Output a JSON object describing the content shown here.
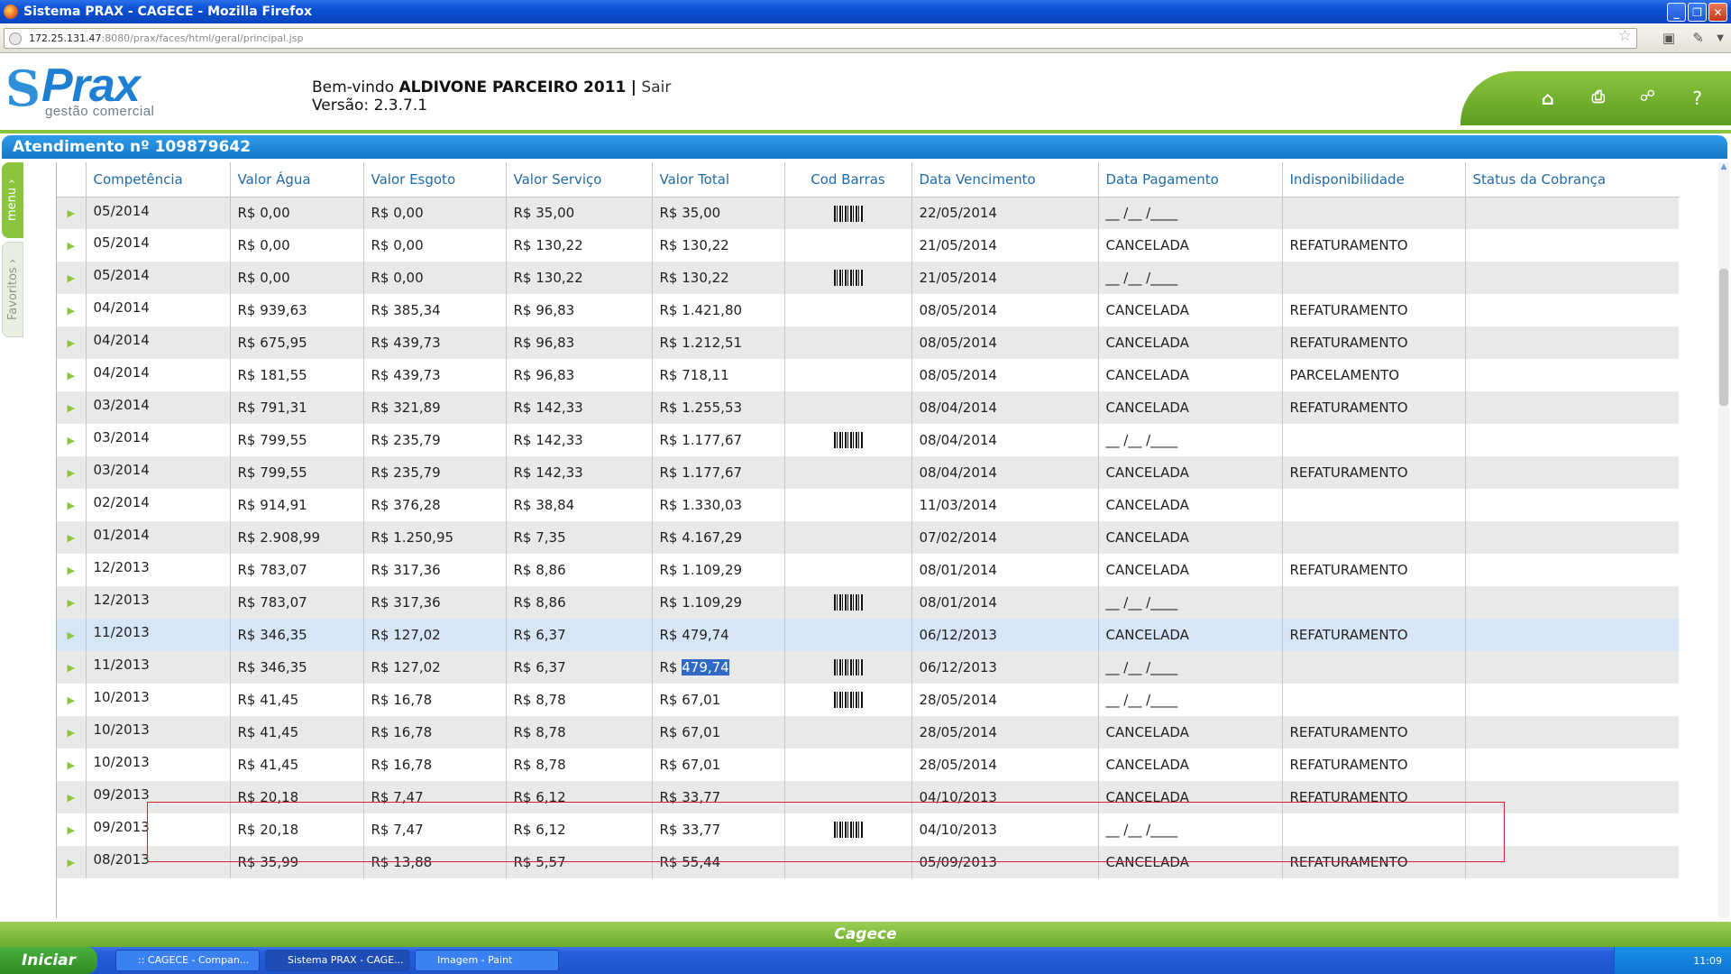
{
  "window": {
    "title": "Sistema PRAX - CAGECE - Mozilla Firefox",
    "minimize_glyph": "_",
    "maximize_glyph": "❐",
    "close_glyph": "✕"
  },
  "browser": {
    "url_host": "172.25.131.47",
    "url_rest": ":8080/prax/faces/html/geral/principal.jsp"
  },
  "app": {
    "logo_mark": "S",
    "logo_text": "Prax",
    "logo_subtitle": "gestão comercial",
    "welcome_prefix": "Bem-vindo",
    "user_name": "ALDIVONE PARCEIRO 2011",
    "separator": "|",
    "logout_label": "Sair",
    "version_label": "Versão: 2.3.7.1",
    "header_icons": [
      "home-icon",
      "print-icon",
      "sitemap-icon",
      "help-icon"
    ],
    "help_glyph": "?",
    "atendimento_title": "Atendimento nº 109879642",
    "side_tab_menu": "menu",
    "side_tab_favoritos": "Favoritos",
    "footer_brand": "Cagece"
  },
  "table": {
    "columns": [
      "Competência",
      "Valor Água",
      "Valor Esgoto",
      "Valor Serviço",
      "Valor Total",
      "Cod Barras",
      "Data Vencimento",
      "Data Pagamento",
      "Indisponibilidade",
      "Status da Cobrança"
    ],
    "rows": [
      {
        "competencia": "05/2014",
        "agua": "R$ 0,00",
        "esgoto": "R$ 0,00",
        "servico": "R$ 35,00",
        "total": "R$ 35,00",
        "barcode": true,
        "vencimento": "22/05/2014",
        "pagamento": "__ /__ /____",
        "indisp": "",
        "status": ""
      },
      {
        "competencia": "05/2014",
        "agua": "R$ 0,00",
        "esgoto": "R$ 0,00",
        "servico": "R$ 130,22",
        "total": "R$ 130,22",
        "barcode": false,
        "vencimento": "21/05/2014",
        "pagamento": "CANCELADA",
        "indisp": "REFATURAMENTO",
        "status": ""
      },
      {
        "competencia": "05/2014",
        "agua": "R$ 0,00",
        "esgoto": "R$ 0,00",
        "servico": "R$ 130,22",
        "total": "R$ 130,22",
        "barcode": true,
        "vencimento": "21/05/2014",
        "pagamento": "__ /__ /____",
        "indisp": "",
        "status": ""
      },
      {
        "competencia": "04/2014",
        "agua": "R$ 939,63",
        "esgoto": "R$ 385,34",
        "servico": "R$ 96,83",
        "total": "R$ 1.421,80",
        "barcode": false,
        "vencimento": "08/05/2014",
        "pagamento": "CANCELADA",
        "indisp": "REFATURAMENTO",
        "status": ""
      },
      {
        "competencia": "04/2014",
        "agua": "R$ 675,95",
        "esgoto": "R$ 439,73",
        "servico": "R$ 96,83",
        "total": "R$ 1.212,51",
        "barcode": false,
        "vencimento": "08/05/2014",
        "pagamento": "CANCELADA",
        "indisp": "REFATURAMENTO",
        "status": ""
      },
      {
        "competencia": "04/2014",
        "agua": "R$ 181,55",
        "esgoto": "R$ 439,73",
        "servico": "R$ 96,83",
        "total": "R$ 718,11",
        "barcode": false,
        "vencimento": "08/05/2014",
        "pagamento": "CANCELADA",
        "indisp": "PARCELAMENTO",
        "status": ""
      },
      {
        "competencia": "03/2014",
        "agua": "R$ 791,31",
        "esgoto": "R$ 321,89",
        "servico": "R$ 142,33",
        "total": "R$ 1.255,53",
        "barcode": false,
        "vencimento": "08/04/2014",
        "pagamento": "CANCELADA",
        "indisp": "REFATURAMENTO",
        "status": ""
      },
      {
        "competencia": "03/2014",
        "agua": "R$ 799,55",
        "esgoto": "R$ 235,79",
        "servico": "R$ 142,33",
        "total": "R$ 1.177,67",
        "barcode": true,
        "vencimento": "08/04/2014",
        "pagamento": "__ /__ /____",
        "indisp": "",
        "status": ""
      },
      {
        "competencia": "03/2014",
        "agua": "R$ 799,55",
        "esgoto": "R$ 235,79",
        "servico": "R$ 142,33",
        "total": "R$ 1.177,67",
        "barcode": false,
        "vencimento": "08/04/2014",
        "pagamento": "CANCELADA",
        "indisp": "REFATURAMENTO",
        "status": ""
      },
      {
        "competencia": "02/2014",
        "agua": "R$ 914,91",
        "esgoto": "R$ 376,28",
        "servico": "R$ 38,84",
        "total": "R$ 1.330,03",
        "barcode": false,
        "vencimento": "11/03/2014",
        "pagamento": "CANCELADA",
        "indisp": "",
        "status": ""
      },
      {
        "competencia": "01/2014",
        "agua": "R$ 2.908,99",
        "esgoto": "R$ 1.250,95",
        "servico": "R$ 7,35",
        "total": "R$ 4.167,29",
        "barcode": false,
        "vencimento": "07/02/2014",
        "pagamento": "CANCELADA",
        "indisp": "",
        "status": ""
      },
      {
        "competencia": "12/2013",
        "agua": "R$ 783,07",
        "esgoto": "R$ 317,36",
        "servico": "R$ 8,86",
        "total": "R$ 1.109,29",
        "barcode": false,
        "vencimento": "08/01/2014",
        "pagamento": "CANCELADA",
        "indisp": "REFATURAMENTO",
        "status": ""
      },
      {
        "competencia": "12/2013",
        "agua": "R$ 783,07",
        "esgoto": "R$ 317,36",
        "servico": "R$ 8,86",
        "total": "R$ 1.109,29",
        "barcode": true,
        "vencimento": "08/01/2014",
        "pagamento": "__ /__ /____",
        "indisp": "",
        "status": ""
      },
      {
        "competencia": "11/2013",
        "agua": "R$ 346,35",
        "esgoto": "R$ 127,02",
        "servico": "R$ 6,37",
        "total": "R$ 479,74",
        "barcode": false,
        "vencimento": "06/12/2013",
        "pagamento": "CANCELADA",
        "indisp": "REFATURAMENTO",
        "status": ""
      },
      {
        "competencia": "11/2013",
        "agua": "R$ 346,35",
        "esgoto": "R$ 127,02",
        "servico": "R$ 6,37",
        "total": "R$ 479,74",
        "barcode": true,
        "vencimento": "06/12/2013",
        "pagamento": "__ /__ /____",
        "indisp": "",
        "status": ""
      },
      {
        "competencia": "10/2013",
        "agua": "R$ 41,45",
        "esgoto": "R$ 16,78",
        "servico": "R$ 8,78",
        "total": "R$ 67,01",
        "barcode": true,
        "vencimento": "28/05/2014",
        "pagamento": "__ /__ /____",
        "indisp": "",
        "status": ""
      },
      {
        "competencia": "10/2013",
        "agua": "R$ 41,45",
        "esgoto": "R$ 16,78",
        "servico": "R$ 8,78",
        "total": "R$ 67,01",
        "barcode": false,
        "vencimento": "28/05/2014",
        "pagamento": "CANCELADA",
        "indisp": "REFATURAMENTO",
        "status": ""
      },
      {
        "competencia": "10/2013",
        "agua": "R$ 41,45",
        "esgoto": "R$ 16,78",
        "servico": "R$ 8,78",
        "total": "R$ 67,01",
        "barcode": false,
        "vencimento": "28/05/2014",
        "pagamento": "CANCELADA",
        "indisp": "REFATURAMENTO",
        "status": ""
      },
      {
        "competencia": "09/2013",
        "agua": "R$ 20,18",
        "esgoto": "R$ 7,47",
        "servico": "R$ 6,12",
        "total": "R$ 33,77",
        "barcode": false,
        "vencimento": "04/10/2013",
        "pagamento": "CANCELADA",
        "indisp": "REFATURAMENTO",
        "status": ""
      },
      {
        "competencia": "09/2013",
        "agua": "R$ 20,18",
        "esgoto": "R$ 7,47",
        "servico": "R$ 6,12",
        "total": "R$ 33,77",
        "barcode": true,
        "vencimento": "04/10/2013",
        "pagamento": "__ /__ /____",
        "indisp": "",
        "status": ""
      },
      {
        "competencia": "08/2013",
        "agua": "R$ 35,99",
        "esgoto": "R$ 13,88",
        "servico": "R$ 5,57",
        "total": "R$ 55,44",
        "barcode": false,
        "vencimento": "05/09/2013",
        "pagamento": "CANCELADA",
        "indisp": "REFATURAMENTO",
        "status": ""
      }
    ],
    "selected_row_index": 13,
    "highlighted_text": {
      "row_index": 14,
      "prefix": "R$ ",
      "selected": "479,74"
    }
  },
  "taskbar": {
    "start_label": "Iniciar",
    "tasks": [
      ":: CAGECE - Compan...",
      "Sistema PRAX - CAGE...",
      "Imagem - Paint"
    ],
    "clock": "11:09"
  },
  "colors": {
    "accent_green": "#8bc53f",
    "accent_blue": "#1f6aa8",
    "selection_border": "#d6222c"
  }
}
